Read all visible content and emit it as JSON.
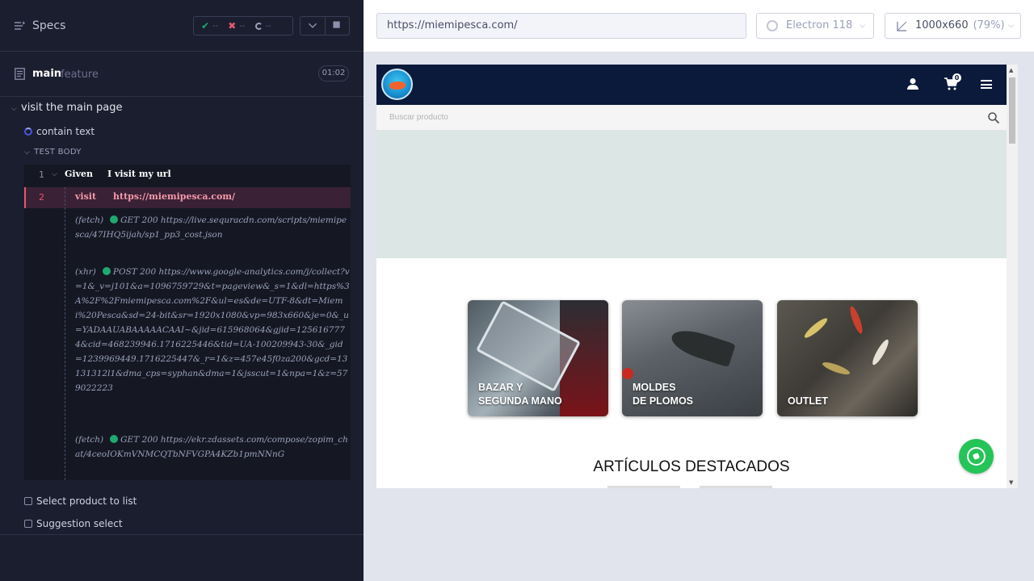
{
  "reporter": {
    "specs_label": "Specs",
    "stats": {
      "passed": "--",
      "failed": "--",
      "pending": "--"
    },
    "file": {
      "name": "main",
      "ext": "feature",
      "duration": "01:02"
    },
    "suite": "visit the main page",
    "current_test": "contain text",
    "test_body_label": "TEST BODY",
    "commands": [
      {
        "num": "1",
        "keyword": "Given",
        "text": "I visit my url"
      },
      {
        "num": "2",
        "keyword": "visit",
        "text": "https://miemipesca.com/"
      }
    ],
    "network": [
      {
        "type": "(fetch)",
        "text": "GET 200 https://live.sequracdn.com/scripts/miemipesca/47IHQ5ijah/sp1_pp3_cost.json"
      },
      {
        "type": "(xhr)",
        "text": "POST 200 https://www.google-analytics.com/j/collect?v=1&_v=j101&a=1096759729&t=pageview&_s=1&dl=https%3A%2F%2Fmiemipesca.com%2F&ul=es&de=UTF-8&dt=Miemi%20Pesca&sd=24-bit&sr=1920x1080&vp=983x660&je=0&_u=YADAAUABAAAAACAAI~&jid=615968064&gjid=1256167774&cid=468239946.1716225446&tid=UA-100209943-30&_gid=1239969449.1716225447&_r=1&z=457e45f0za200&gcd=13131312l1&dma_cps=syphan&dma=1&jsscut=1&npa=1&z=579022223"
      },
      {
        "type": "(fetch)",
        "text": "GET 200 https://ekr.zdassets.com/compose/zopim_chat/4ceoIOKmVNMCQTbNFVGPA4KZb1pmNNnG"
      }
    ],
    "other_tests": [
      "Select product to list",
      "Suggestion select"
    ]
  },
  "browser_bar": {
    "url": "https://miemipesca.com/",
    "browser": "Electron 118",
    "viewport": "1000x660",
    "zoom": "(79%)"
  },
  "site": {
    "cart_count": "0",
    "search_placeholder": "Buscar producto",
    "categories": [
      {
        "line1": "BAZAR Y",
        "line2": "SEGUNDA MANO"
      },
      {
        "line1": "MOLDES",
        "line2": "DE PLOMOS"
      },
      {
        "line1": "",
        "line2": "OUTLET"
      }
    ],
    "featured_title": "ARTÍCULOS DESTACADOS"
  },
  "colors": {
    "reporter_bg": "#1b1e2e",
    "failed_row": "#3a2136",
    "site_header": "#0b1a3a",
    "whatsapp": "#25c458"
  }
}
